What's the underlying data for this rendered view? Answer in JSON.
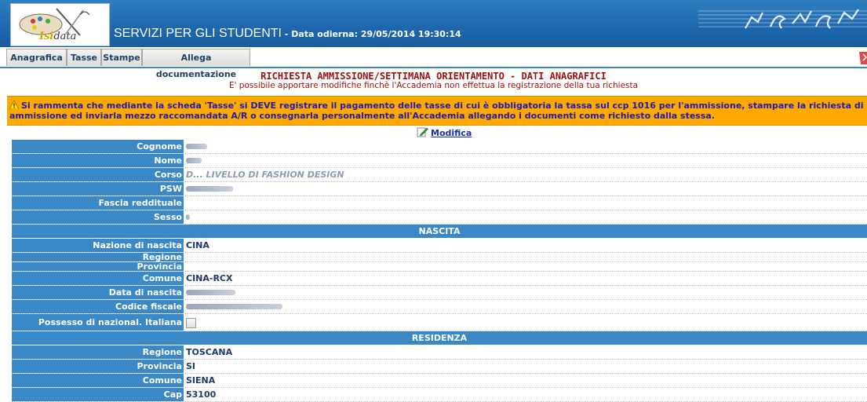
{
  "header": {
    "logo_prefix": "Isi",
    "logo_suffix": "data",
    "title": "SERVIZI PER GLI STUDENTI",
    "date_label": " - Data odierna: 29/05/2014 19:30:14"
  },
  "tabs": [
    "Anagrafica",
    "Tasse",
    "Stampe",
    "Allega documentazione"
  ],
  "page": {
    "heading": "RICHIESTA AMMISSIONE/SETTIMANA ORIENTAMENTO - DATI ANAGRAFICI",
    "subheading": "E' possibile apportare modifiche finchè l'Accademia non effettua la registrazione della tua richiesta",
    "warning": "Si rammenta che mediante la scheda 'Tasse' si DEVE registrare il pagamento delle tasse di cui è obbligatoria la tassa sul ccp 1016 per l'ammissione, stampare la richiesta di ammissione ed inviarla mezzo raccomandata A/R o consegnarla personalmente all'Accademia allegando i documenti come richiesto dalla stessa.",
    "modifica": "Modifica"
  },
  "anagrafica": {
    "cognome_label": "Cognome",
    "nome_label": "Nome",
    "corso_label": "Corso",
    "corso_value": "D... LIVELLO DI FASHION DESIGN",
    "psw_label": "PSW",
    "fascia_label": "Fascia reddituale",
    "sesso_label": "Sesso"
  },
  "nascita": {
    "section": "NASCITA",
    "nazione_label": "Nazione di nascita",
    "nazione_value": "CINA",
    "regione_label": "Regione",
    "provincia_label": "Provincia",
    "comune_label": "Comune",
    "comune_value": "CINA-RCX",
    "data_label": "Data di nascita",
    "cf_label": "Codice fiscale",
    "possesso_label": "Possesso di nazional. Italiana"
  },
  "residenza": {
    "section": "RESIDENZA",
    "regione_label": "Regione",
    "regione_value": "TOSCANA",
    "provincia_label": "Provincia",
    "provincia_value": "SI",
    "comune_label": "Comune",
    "comune_value": "SIENA",
    "cap_label": "Cap",
    "cap_value": "53100"
  },
  "colors": {
    "header_blue": "#1f67ad",
    "label_blue": "#3a88c6",
    "warning_orange": "#ffa800",
    "heading_red": "#9c1010"
  },
  "icons": [
    "palette-logo-icon",
    "music-notes-icon",
    "warning-icon",
    "edit-icon",
    "corner-icon"
  ]
}
